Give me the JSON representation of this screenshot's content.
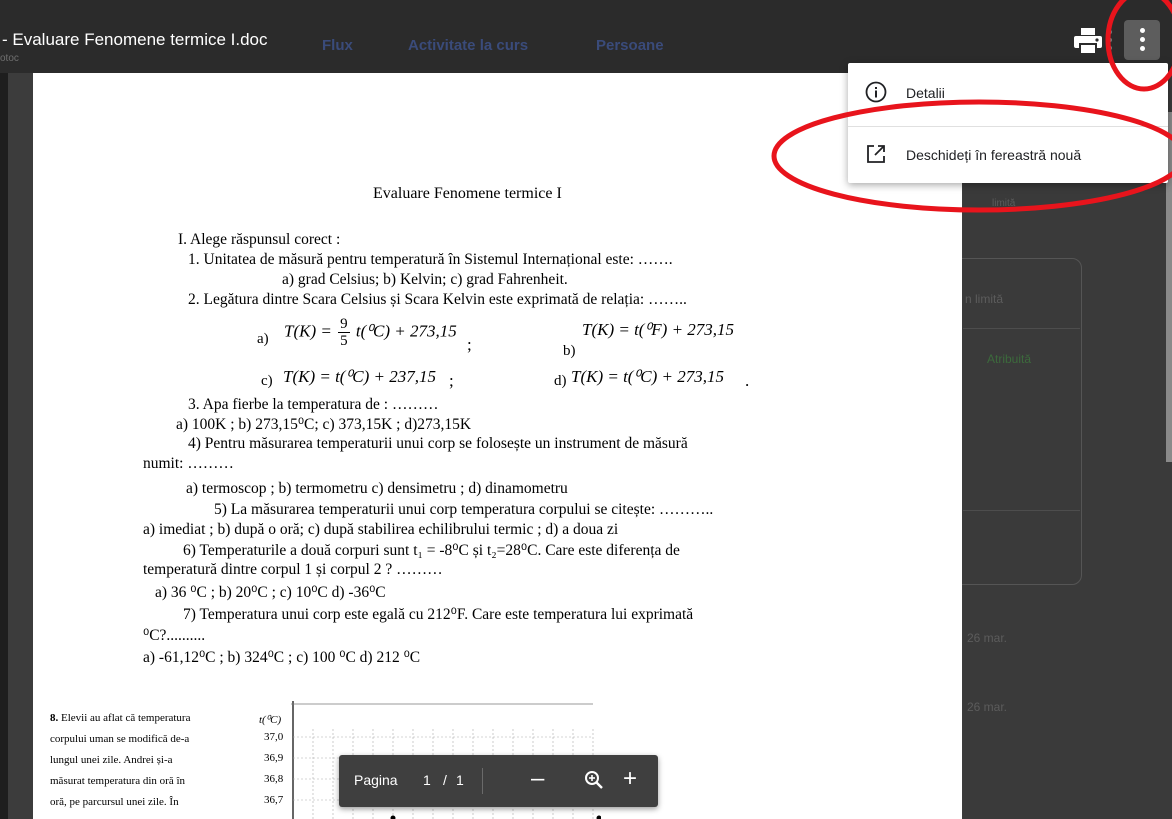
{
  "header": {
    "title": "- Evaluare Fenomene termice I.doc",
    "subtitle": "otoc",
    "bg_tabs": [
      "Flux",
      "Activitate la curs",
      "Persoane"
    ],
    "print_icon": "print-icon",
    "more_icon": "more-vert-icon"
  },
  "menu": {
    "items": [
      {
        "label": "Detalii",
        "icon": "info-icon"
      },
      {
        "label": "Deschideți în fereastră nouă",
        "icon": "open-in-new-icon"
      }
    ]
  },
  "background_panel": {
    "texts": [
      "limită",
      "n limită",
      "Atribuită",
      "26 mar.",
      "26 mar."
    ]
  },
  "pager": {
    "label": "Pagina",
    "current": "1",
    "separator": "/",
    "total": "1",
    "zoom_out_icon": "minus-icon",
    "zoom_icon": "zoom-icon",
    "zoom_in_icon": "plus-icon"
  },
  "document": {
    "title": "Evaluare Fenomene termice I",
    "lines": [
      "I. Alege răspunsul corect :",
      "1. Unitatea de măsură pentru temperatură în Sistemul Internațional este: …….",
      "a) grad Celsius;     b) Kelvin;   c) grad Fahrenheit.",
      "2. Legătura dintre Scara Celsius și Scara Kelvin este exprimată de relația: ……..",
      "3. Apa fierbe  la temperatura de : ………",
      "a) 100K ;    b) 273,15⁰C;    c) 373,15K ;    d)273,15K",
      "4)   Pentru măsurarea temperaturii unui corp se folosește un instrument de măsură",
      "numit: ………",
      "a) termoscop ;  b) termometru   c) densimetru ;       d) dinamometru",
      "5)   La măsurarea temperaturii unui corp temperatura corpului  se citește: ………..",
      "a) imediat ;  b) după o oră;   c) după stabilirea echilibrului termic ; d) a doua zi",
      "6) Temperaturile a două corpuri sunt t₁ = -8⁰C și t₂=28⁰C. Care este diferența de",
      "temperatură dintre corpul 1 și corpul 2 ? ………",
      "a) 36 ⁰C ; b) 20⁰C ; c) 10⁰C d) -36⁰C",
      "7)  Temperatura unui corp este egală cu 212⁰F. Care este temperatura lui exprimată",
      "⁰C?..........",
      "a) -61,12⁰C ;  b) 324⁰C ; c) 100 ⁰C  d) 212 ⁰C"
    ],
    "formulas": {
      "a_label": "a)",
      "a_left": "T(K) =",
      "a_num": "9",
      "a_den": "5",
      "a_right": "t(⁰C) + 273,15",
      "a_end": ";",
      "b_label": "b)",
      "b_expr": "T(K) = t(⁰F) + 273,15",
      "c_label": "c)",
      "c_expr": "T(K) = t(⁰C) + 237,15",
      "c_end": ";",
      "d_label": "d)",
      "d_expr": "T(K) = t(⁰C) + 273,15",
      "d_end": "."
    },
    "q8": {
      "number": "8.",
      "lines": [
        "Elevii au aflat că temperatura",
        "corpului uman se modifică de-a",
        "lungul unei zile. Andrei și-a",
        "măsurat temperatura din oră în",
        "oră, pe parcursul unei zile. În"
      ],
      "axis_label": "t(⁰C)",
      "ticks": [
        "37,0",
        "36,9",
        "36,8",
        "36,7"
      ]
    }
  },
  "colors": {
    "annotation_red": "#e8141c",
    "topbar": "#2b2b2b",
    "menu_bg": "#ffffff"
  }
}
